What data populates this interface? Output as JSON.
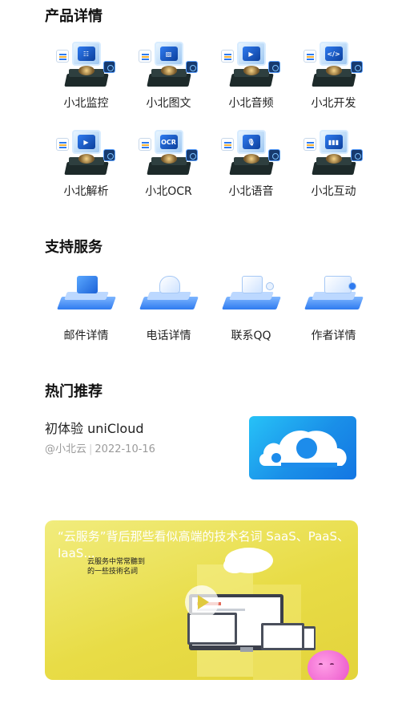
{
  "products": {
    "title": "产品详情",
    "items": [
      {
        "label": "小北监控",
        "icon": "monitor-icon",
        "core": "☷"
      },
      {
        "label": "小北图文",
        "icon": "image-text-icon",
        "core": "▨"
      },
      {
        "label": "小北音频",
        "icon": "audio-icon",
        "core": "▶"
      },
      {
        "label": "小北开发",
        "icon": "dev-icon",
        "core": "</>"
      },
      {
        "label": "小北解析",
        "icon": "parse-icon",
        "core": "▶"
      },
      {
        "label": "小北OCR",
        "icon": "ocr-icon",
        "core": "OCR"
      },
      {
        "label": "小北语音",
        "icon": "voice-icon",
        "core": "🎙"
      },
      {
        "label": "小北互动",
        "icon": "interact-icon",
        "core": "▮▮▮"
      }
    ]
  },
  "services": {
    "title": "支持服务",
    "items": [
      {
        "label": "邮件详情",
        "icon": "mail-icon"
      },
      {
        "label": "电话详情",
        "icon": "phone-icon"
      },
      {
        "label": "联系QQ",
        "icon": "qq-icon"
      },
      {
        "label": "作者详情",
        "icon": "author-icon"
      }
    ]
  },
  "hot": {
    "title": "热门推荐",
    "item": {
      "title": "初体验 uniCloud",
      "author": "@小北云",
      "date": "2022-10-16",
      "thumb_icon": "unicloud-logo-icon"
    }
  },
  "banner": {
    "title": "“云服务”背后那些看似高端的技术名词 SaaS、PaaS、IaaS...",
    "subtitle": "云服务中常常聽到的一些技術名詞",
    "play_icon": "play-icon"
  },
  "colors": {
    "accent": "#2f7bf0",
    "banner_bg": "#e8dc46",
    "thumb_bg": "#1a8fe8"
  }
}
